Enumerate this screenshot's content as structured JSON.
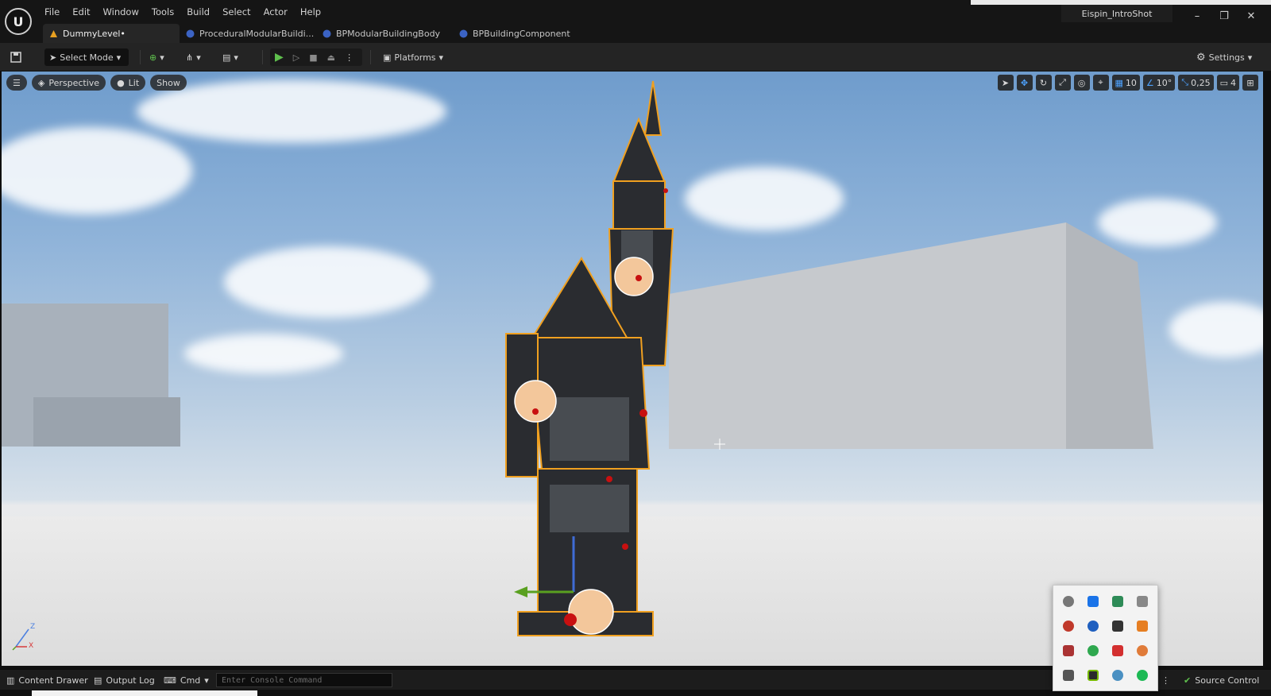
{
  "menu": [
    "File",
    "Edit",
    "Window",
    "Tools",
    "Build",
    "Select",
    "Actor",
    "Help"
  ],
  "window": {
    "title": "Eispin_IntroShot"
  },
  "tabs": [
    {
      "label": "DummyLevel•",
      "active": true,
      "icon": "level-icon"
    },
    {
      "label": "ProceduralModularBuildi...",
      "active": false,
      "icon": "blueprint-icon"
    },
    {
      "label": "BPModularBuildingBody",
      "active": false,
      "icon": "blueprint-icon"
    },
    {
      "label": "BPBuildingComponent",
      "active": false,
      "icon": "blueprint-icon"
    }
  ],
  "toolbar": {
    "select_mode": "Select Mode",
    "platforms": "Platforms",
    "settings": "Settings"
  },
  "viewport": {
    "perspective": "Perspective",
    "lit": "Lit",
    "show": "Show",
    "grid_snap": "10",
    "rotation_snap": "10°",
    "scale_snap": "0,25",
    "camera_speed": "4",
    "axis_z": "Z",
    "axis_x": "X"
  },
  "statusbar": {
    "content_drawer": "Content Drawer",
    "output_log": "Output Log",
    "cmd": "Cmd",
    "console_placeholder": "Enter Console Command",
    "source_control": "Source Control"
  },
  "tray_icons": [
    "gear-tray-icon",
    "bluetooth-icon",
    "shield-icon",
    "usb-icon",
    "paint-icon",
    "sync-icon",
    "ink-icon",
    "box-icon",
    "display-icon",
    "chrome-icon",
    "r-app-icon",
    "settings-app-icon",
    "lock-icon",
    "nvidia-icon",
    "network-icon",
    "spotify-icon"
  ],
  "colors": {
    "accent": "#3f8cff",
    "play": "#5fc04d",
    "selection": "#f0a020"
  }
}
